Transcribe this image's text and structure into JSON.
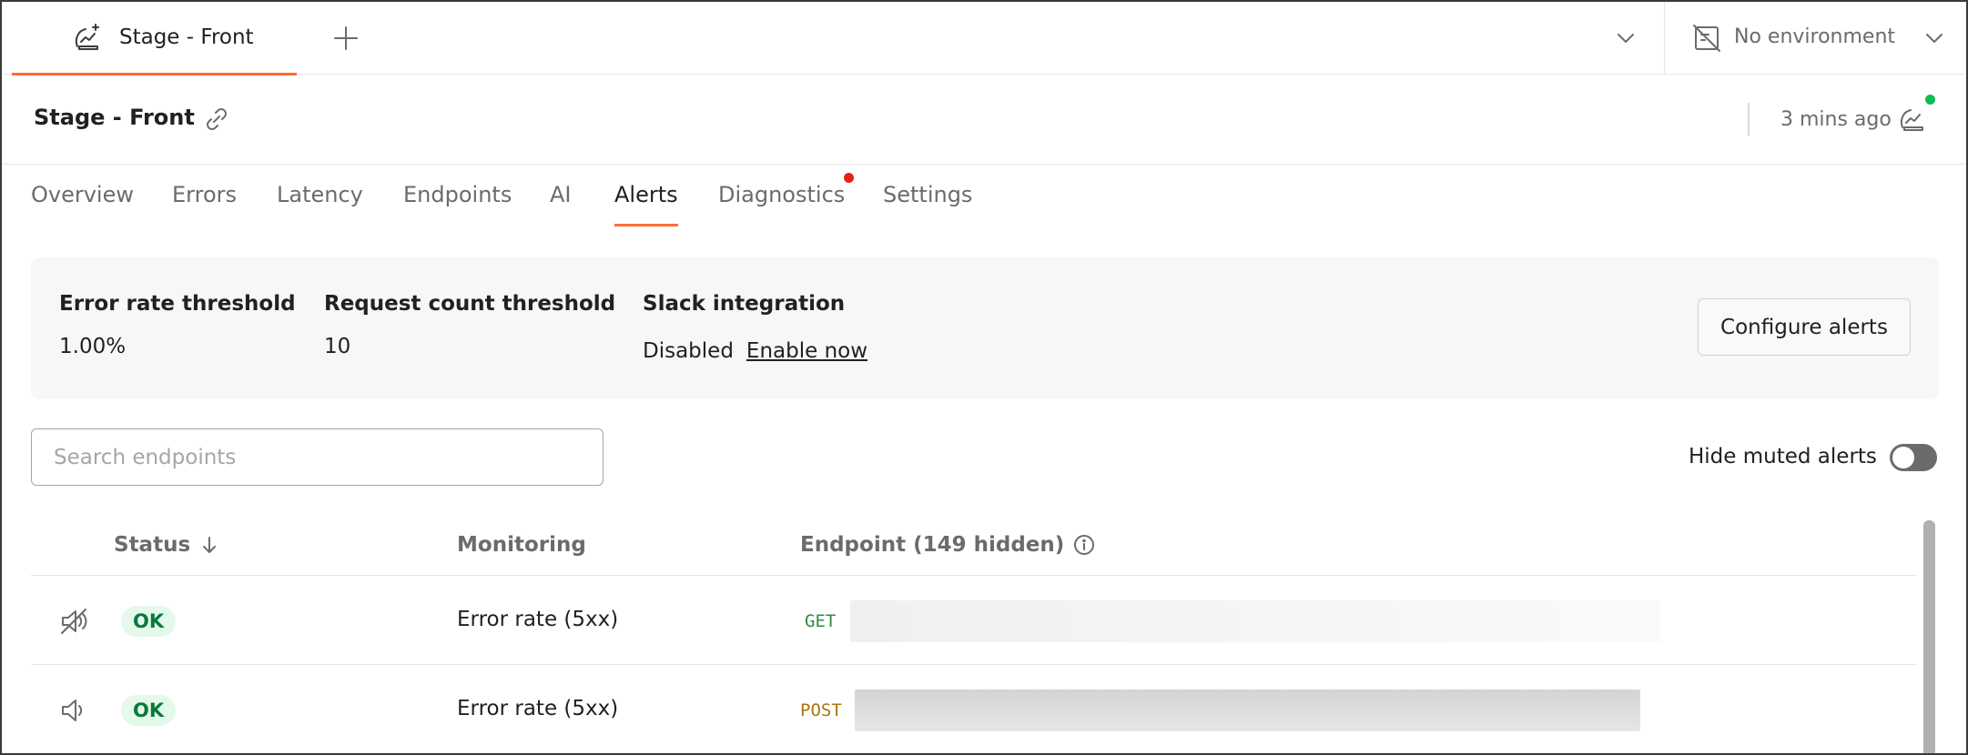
{
  "tab": {
    "label": "Stage - Front",
    "add_icon": "plus-icon"
  },
  "environment": {
    "label": "No environment"
  },
  "header": {
    "title": "Stage - Front",
    "updated": "3 mins ago"
  },
  "nav": {
    "tabs": [
      {
        "label": "Overview"
      },
      {
        "label": "Errors"
      },
      {
        "label": "Latency"
      },
      {
        "label": "Endpoints"
      },
      {
        "label": "AI"
      },
      {
        "label": "Alerts",
        "active": true
      },
      {
        "label": "Diagnostics",
        "badge": "red-dot"
      },
      {
        "label": "Settings"
      }
    ]
  },
  "summary": {
    "error_rate": {
      "title": "Error rate threshold",
      "value": "1.00%"
    },
    "request_count": {
      "title": "Request count threshold",
      "value": "10"
    },
    "slack": {
      "title": "Slack integration",
      "status": "Disabled",
      "link": "Enable now"
    },
    "configure_label": "Configure alerts"
  },
  "search": {
    "placeholder": "Search endpoints",
    "value": ""
  },
  "hide_muted": {
    "label": "Hide muted alerts",
    "enabled": false
  },
  "table": {
    "columns": {
      "status": "Status",
      "monitoring": "Monitoring",
      "endpoint": "Endpoint (149 hidden)"
    },
    "rows": [
      {
        "muted": true,
        "status": "OK",
        "monitoring": "Error rate (5xx)",
        "method": "GET"
      },
      {
        "muted": false,
        "status": "OK",
        "monitoring": "Error rate (5xx)",
        "method": "POST"
      }
    ]
  },
  "colors": {
    "accent": "#ff6c37",
    "ok_text": "#067a3a",
    "ok_bg": "#e5f8ec",
    "get_method": "#2f8b3e",
    "post_method": "#a8760b",
    "online_dot": "#0cbb52",
    "notification_dot": "#eb2013"
  }
}
